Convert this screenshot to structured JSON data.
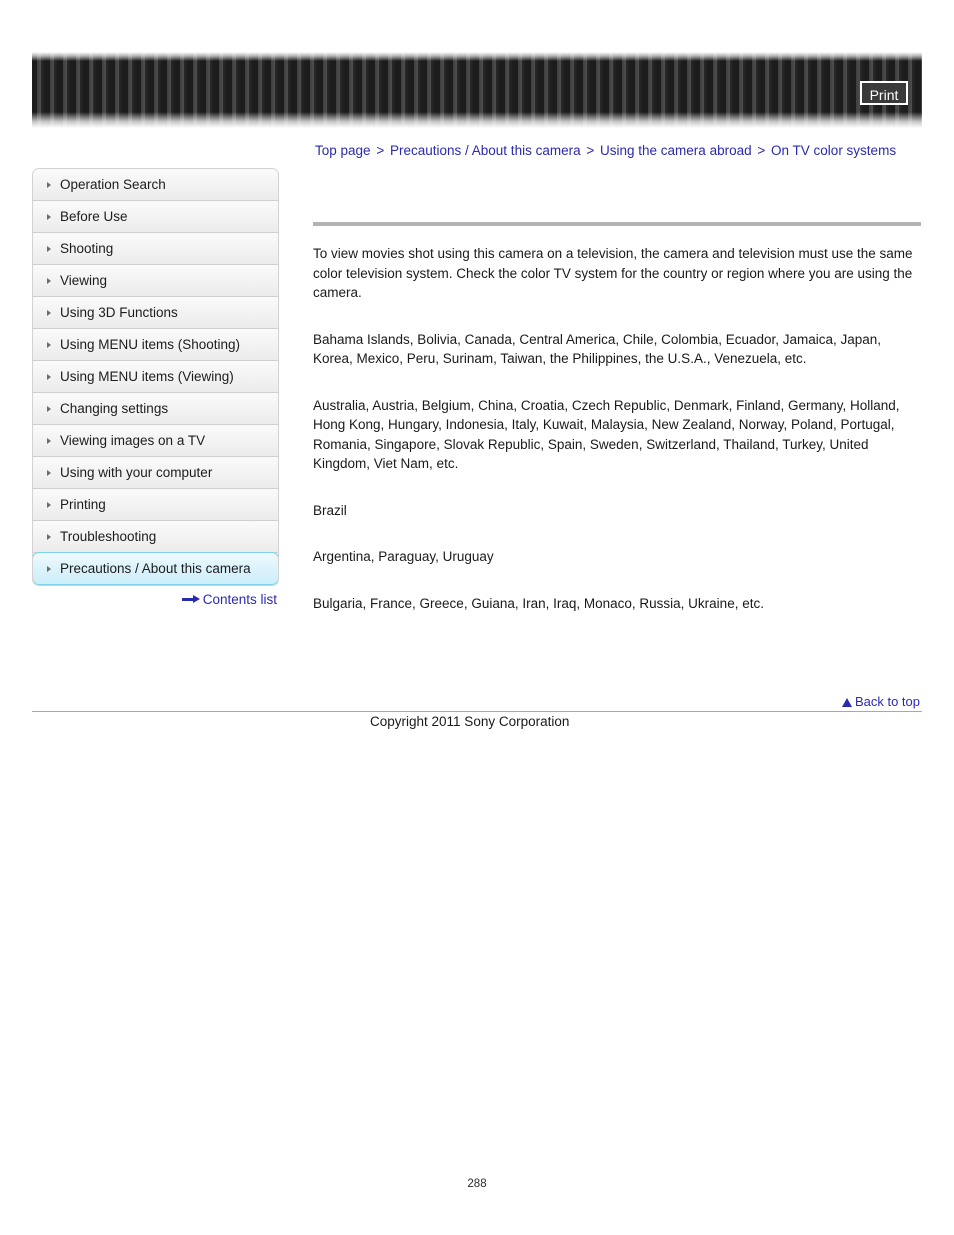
{
  "header": {
    "print_label": "Print"
  },
  "breadcrumb": {
    "separator": ">",
    "items": [
      {
        "label": "Top page"
      },
      {
        "label": "Precautions / About this camera"
      },
      {
        "label": "Using the camera abroad"
      },
      {
        "label": "On TV color systems"
      }
    ]
  },
  "sidebar": {
    "items": [
      {
        "label": "Operation Search",
        "active": false
      },
      {
        "label": "Before Use",
        "active": false
      },
      {
        "label": "Shooting",
        "active": false
      },
      {
        "label": "Viewing",
        "active": false
      },
      {
        "label": "Using 3D Functions",
        "active": false
      },
      {
        "label": "Using MENU items (Shooting)",
        "active": false
      },
      {
        "label": "Using MENU items (Viewing)",
        "active": false
      },
      {
        "label": "Changing settings",
        "active": false
      },
      {
        "label": "Viewing images on a TV",
        "active": false
      },
      {
        "label": "Using with your computer",
        "active": false
      },
      {
        "label": "Printing",
        "active": false
      },
      {
        "label": "Troubleshooting",
        "active": false
      },
      {
        "label": "Precautions / About this camera",
        "active": true
      }
    ],
    "contents_list_label": "Contents list"
  },
  "content": {
    "intro": "To view movies shot using this camera on a television, the camera and television must use the same color television system. Check the color TV system for the country or region where you are using the camera.",
    "paragraphs": [
      "Bahama Islands, Bolivia, Canada, Central America, Chile, Colombia, Ecuador, Jamaica, Japan, Korea, Mexico, Peru, Surinam, Taiwan, the Philippines, the U.S.A., Venezuela, etc.",
      "Australia, Austria, Belgium, China, Croatia, Czech Republic, Denmark, Finland, Germany, Holland, Hong Kong, Hungary, Indonesia, Italy, Kuwait, Malaysia, New Zealand, Norway, Poland, Portugal, Romania, Singapore, Slovak Republic, Spain, Sweden, Switzerland, Thailand, Turkey, United Kingdom, Viet Nam, etc.",
      "Brazil",
      "Argentina, Paraguay, Uruguay",
      "Bulgaria, France, Greece, Guiana, Iran, Iraq, Monaco, Russia, Ukraine, etc."
    ]
  },
  "footer": {
    "back_to_top_label": "Back to top",
    "copyright": "Copyright 2011 Sony Corporation"
  },
  "page": {
    "number": "288"
  },
  "colors": {
    "link": "#2a2ab0",
    "active_nav_border": "#7fd2e8",
    "rule": "#b3b3b3"
  }
}
